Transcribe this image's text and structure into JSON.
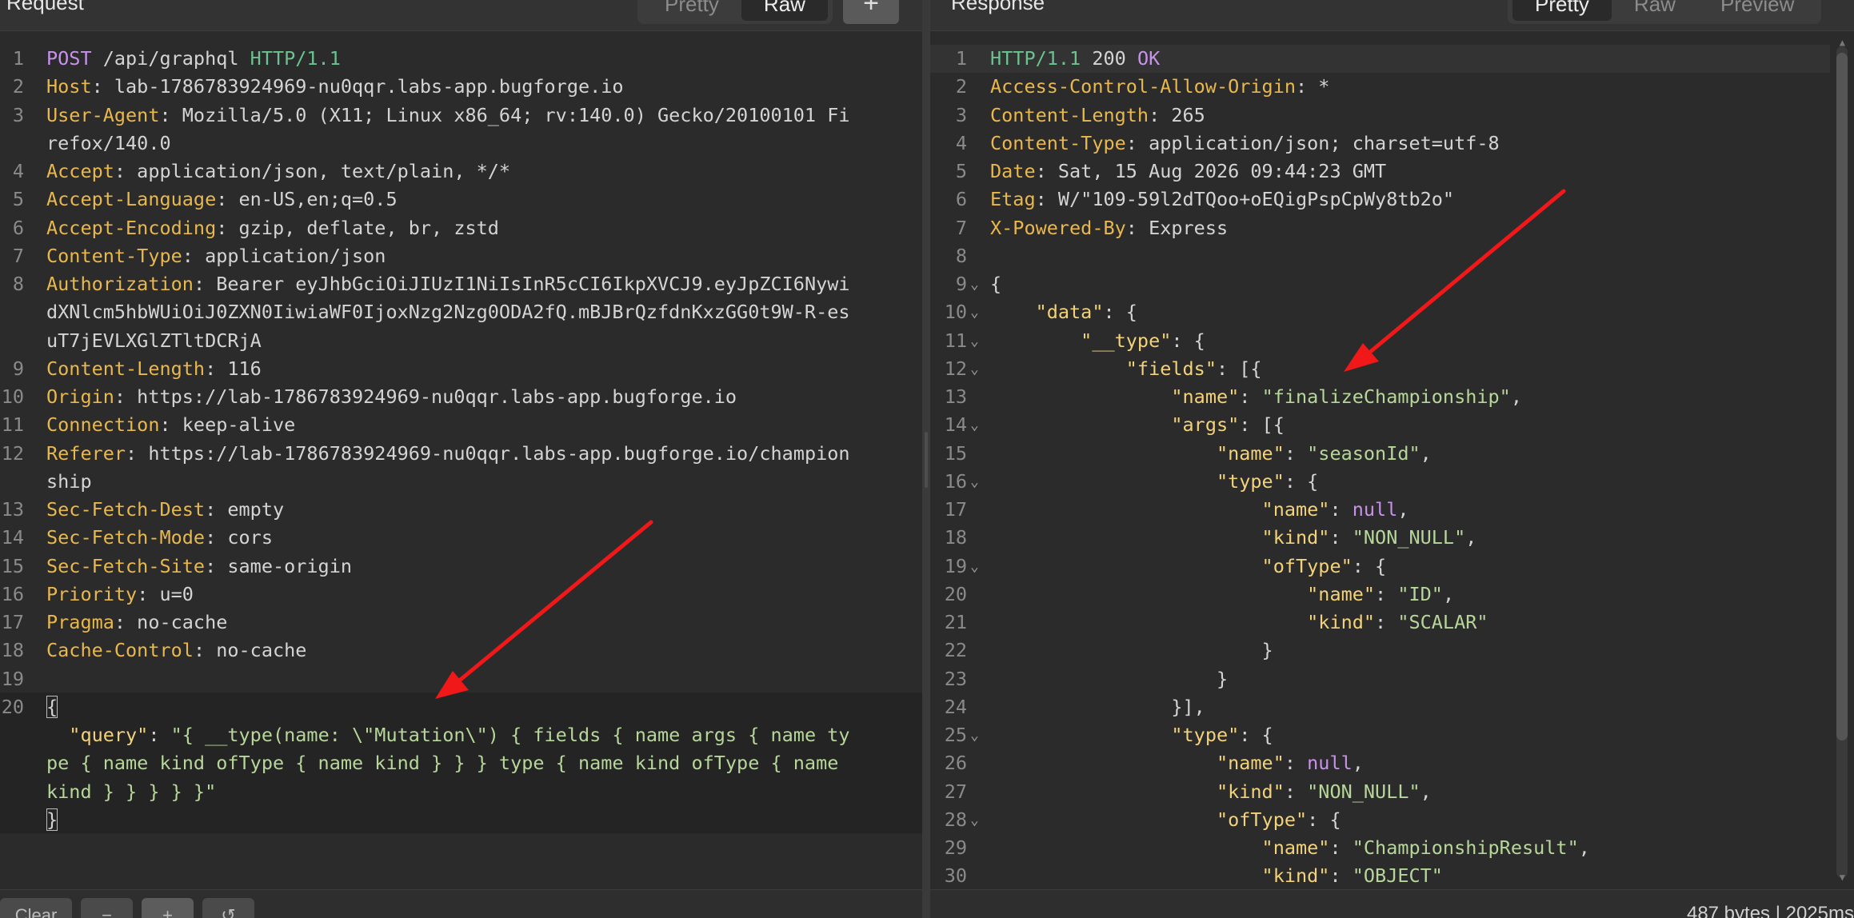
{
  "request": {
    "title": "Request",
    "tabs": [
      "Pretty",
      "Raw"
    ],
    "add_label": "+",
    "lines": [
      {
        "n": "1",
        "t": [
          {
            "c": "mt",
            "v": "POST"
          },
          {
            "c": "pl",
            "v": " /api/graphql "
          },
          {
            "c": "pr",
            "v": "HTTP/1.1"
          }
        ]
      },
      {
        "n": "2",
        "t": [
          {
            "c": "k",
            "v": "Host"
          },
          {
            "c": "pl",
            "v": ": lab-1786783924969-nu0qqr.labs-app.bugforge.io"
          }
        ]
      },
      {
        "n": "3",
        "t": [
          {
            "c": "k",
            "v": "User-Agent"
          },
          {
            "c": "pl",
            "v": ": Mozilla/5.0 (X11; Linux x86_64; rv:140.0) Gecko/20100101 Fi"
          }
        ]
      },
      {
        "n": "",
        "t": [
          {
            "c": "pl",
            "v": "refox/140.0"
          }
        ]
      },
      {
        "n": "4",
        "t": [
          {
            "c": "k",
            "v": "Accept"
          },
          {
            "c": "pl",
            "v": ": application/json, text/plain, */*"
          }
        ]
      },
      {
        "n": "5",
        "t": [
          {
            "c": "k",
            "v": "Accept-Language"
          },
          {
            "c": "pl",
            "v": ": en-US,en;q=0.5"
          }
        ]
      },
      {
        "n": "6",
        "t": [
          {
            "c": "k",
            "v": "Accept-Encoding"
          },
          {
            "c": "pl",
            "v": ": gzip, deflate, br, zstd"
          }
        ]
      },
      {
        "n": "7",
        "t": [
          {
            "c": "k",
            "v": "Content-Type"
          },
          {
            "c": "pl",
            "v": ": application/json"
          }
        ]
      },
      {
        "n": "8",
        "t": [
          {
            "c": "k",
            "v": "Authorization"
          },
          {
            "c": "pl",
            "v": ": Bearer eyJhbGciOiJIUzI1NiIsInR5cCI6IkpXVCJ9.eyJpZCI6Nywi"
          }
        ]
      },
      {
        "n": "",
        "t": [
          {
            "c": "pl",
            "v": "dXNlcm5hbWUiOiJ0ZXN0IiwiaWF0IjoxNzg2Nzg0ODA2fQ.mBJBrQzfdnKxzGG0t9W-R-es"
          }
        ]
      },
      {
        "n": "",
        "t": [
          {
            "c": "pl",
            "v": "uT7jEVLXGlZTltDCRjA"
          }
        ]
      },
      {
        "n": "9",
        "t": [
          {
            "c": "k",
            "v": "Content-Length"
          },
          {
            "c": "pl",
            "v": ": 116"
          }
        ]
      },
      {
        "n": "10",
        "t": [
          {
            "c": "k",
            "v": "Origin"
          },
          {
            "c": "pl",
            "v": ": https://lab-1786783924969-nu0qqr.labs-app.bugforge.io"
          }
        ]
      },
      {
        "n": "11",
        "t": [
          {
            "c": "k",
            "v": "Connection"
          },
          {
            "c": "pl",
            "v": ": keep-alive"
          }
        ]
      },
      {
        "n": "12",
        "t": [
          {
            "c": "k",
            "v": "Referer"
          },
          {
            "c": "pl",
            "v": ": https://lab-1786783924969-nu0qqr.labs-app.bugforge.io/champion"
          }
        ]
      },
      {
        "n": "",
        "t": [
          {
            "c": "pl",
            "v": "ship"
          }
        ]
      },
      {
        "n": "13",
        "t": [
          {
            "c": "k",
            "v": "Sec-Fetch-Dest"
          },
          {
            "c": "pl",
            "v": ": empty"
          }
        ]
      },
      {
        "n": "14",
        "t": [
          {
            "c": "k",
            "v": "Sec-Fetch-Mode"
          },
          {
            "c": "pl",
            "v": ": cors"
          }
        ]
      },
      {
        "n": "15",
        "t": [
          {
            "c": "k",
            "v": "Sec-Fetch-Site"
          },
          {
            "c": "pl",
            "v": ": same-origin"
          }
        ]
      },
      {
        "n": "16",
        "t": [
          {
            "c": "k",
            "v": "Priority"
          },
          {
            "c": "pl",
            "v": ": u=0"
          }
        ]
      },
      {
        "n": "17",
        "t": [
          {
            "c": "k",
            "v": "Pragma"
          },
          {
            "c": "pl",
            "v": ": no-cache"
          }
        ]
      },
      {
        "n": "18",
        "t": [
          {
            "c": "k",
            "v": "Cache-Control"
          },
          {
            "c": "pl",
            "v": ": no-cache"
          }
        ]
      },
      {
        "n": "19",
        "t": []
      },
      {
        "n": "20",
        "t": [
          {
            "c": "pl brk",
            "v": "{"
          }
        ]
      },
      {
        "n": "",
        "t": [
          {
            "c": "jk",
            "v": "  \"query\""
          },
          {
            "c": "pl",
            "v": ": "
          },
          {
            "c": "js",
            "v": "\"{ __type(name: \\\"Mutation\\\") { fields { name args { name ty"
          }
        ]
      },
      {
        "n": "",
        "t": [
          {
            "c": "js",
            "v": "pe { name kind ofType { name kind } } } type { name kind ofType { name"
          }
        ]
      },
      {
        "n": "",
        "t": [
          {
            "c": "js",
            "v": "kind } } } } }\""
          }
        ]
      },
      {
        "n": "",
        "t": [
          {
            "c": "pl brk",
            "v": "}"
          }
        ]
      }
    ],
    "footer": {
      "clear": "Clear",
      "minus": "−",
      "plus": "+",
      "undo": "↺"
    }
  },
  "response": {
    "title": "Response",
    "tabs": [
      "Pretty",
      "Raw",
      "Preview"
    ],
    "lines": [
      {
        "n": "1",
        "t": [
          {
            "c": "pr",
            "v": "HTTP/1.1"
          },
          {
            "c": "pl",
            "v": " 200 "
          },
          {
            "c": "mt",
            "v": "OK"
          }
        ]
      },
      {
        "n": "2",
        "t": [
          {
            "c": "k",
            "v": "Access-Control-Allow-Origin"
          },
          {
            "c": "pl",
            "v": ": *"
          }
        ]
      },
      {
        "n": "3",
        "t": [
          {
            "c": "k",
            "v": "Content-Length"
          },
          {
            "c": "pl",
            "v": ": 265"
          }
        ]
      },
      {
        "n": "4",
        "t": [
          {
            "c": "k",
            "v": "Content-Type"
          },
          {
            "c": "pl",
            "v": ": application/json; charset=utf-8"
          }
        ]
      },
      {
        "n": "5",
        "t": [
          {
            "c": "k",
            "v": "Date"
          },
          {
            "c": "pl",
            "v": ": Sat, 15 Aug 2026 09:44:23 GMT"
          }
        ]
      },
      {
        "n": "6",
        "t": [
          {
            "c": "k",
            "v": "Etag"
          },
          {
            "c": "pl",
            "v": ": W/\"109-59l2dTQoo+oEQigPspCpWy8tb2o\""
          }
        ]
      },
      {
        "n": "7",
        "t": [
          {
            "c": "k",
            "v": "X-Powered-By"
          },
          {
            "c": "pl",
            "v": ": Express"
          }
        ]
      },
      {
        "n": "8",
        "t": []
      },
      {
        "n": "9",
        "f": "⌄",
        "t": [
          {
            "c": "pl",
            "v": "{"
          }
        ]
      },
      {
        "n": "10",
        "f": "⌄",
        "t": [
          {
            "c": "jk",
            "v": "    \"data\""
          },
          {
            "c": "pl",
            "v": ": {"
          }
        ]
      },
      {
        "n": "11",
        "f": "⌄",
        "t": [
          {
            "c": "jk",
            "v": "        \"__type\""
          },
          {
            "c": "pl",
            "v": ": {"
          }
        ]
      },
      {
        "n": "12",
        "f": "⌄",
        "t": [
          {
            "c": "jk",
            "v": "            \"fields\""
          },
          {
            "c": "pl",
            "v": ": [{"
          }
        ]
      },
      {
        "n": "13",
        "t": [
          {
            "c": "jk",
            "v": "                \"name\""
          },
          {
            "c": "pl",
            "v": ": "
          },
          {
            "c": "js",
            "v": "\"finalizeChampionship\""
          },
          {
            "c": "pl",
            "v": ","
          }
        ]
      },
      {
        "n": "14",
        "f": "⌄",
        "t": [
          {
            "c": "jk",
            "v": "                \"args\""
          },
          {
            "c": "pl",
            "v": ": [{"
          }
        ]
      },
      {
        "n": "15",
        "t": [
          {
            "c": "jk",
            "v": "                    \"name\""
          },
          {
            "c": "pl",
            "v": ": "
          },
          {
            "c": "js",
            "v": "\"seasonId\""
          },
          {
            "c": "pl",
            "v": ","
          }
        ]
      },
      {
        "n": "16",
        "f": "⌄",
        "t": [
          {
            "c": "jk",
            "v": "                    \"type\""
          },
          {
            "c": "pl",
            "v": ": {"
          }
        ]
      },
      {
        "n": "17",
        "t": [
          {
            "c": "jk",
            "v": "                        \"name\""
          },
          {
            "c": "pl",
            "v": ": "
          },
          {
            "c": "nl",
            "v": "null"
          },
          {
            "c": "pl",
            "v": ","
          }
        ]
      },
      {
        "n": "18",
        "t": [
          {
            "c": "jk",
            "v": "                        \"kind\""
          },
          {
            "c": "pl",
            "v": ": "
          },
          {
            "c": "js",
            "v": "\"NON_NULL\""
          },
          {
            "c": "pl",
            "v": ","
          }
        ]
      },
      {
        "n": "19",
        "f": "⌄",
        "t": [
          {
            "c": "jk",
            "v": "                        \"ofType\""
          },
          {
            "c": "pl",
            "v": ": {"
          }
        ]
      },
      {
        "n": "20",
        "t": [
          {
            "c": "jk",
            "v": "                            \"name\""
          },
          {
            "c": "pl",
            "v": ": "
          },
          {
            "c": "js",
            "v": "\"ID\""
          },
          {
            "c": "pl",
            "v": ","
          }
        ]
      },
      {
        "n": "21",
        "t": [
          {
            "c": "jk",
            "v": "                            \"kind\""
          },
          {
            "c": "pl",
            "v": ": "
          },
          {
            "c": "js",
            "v": "\"SCALAR\""
          }
        ]
      },
      {
        "n": "22",
        "t": [
          {
            "c": "pl",
            "v": "                        }"
          }
        ]
      },
      {
        "n": "23",
        "t": [
          {
            "c": "pl",
            "v": "                    }"
          }
        ]
      },
      {
        "n": "24",
        "t": [
          {
            "c": "pl",
            "v": "                }],"
          }
        ]
      },
      {
        "n": "25",
        "f": "⌄",
        "t": [
          {
            "c": "jk",
            "v": "                \"type\""
          },
          {
            "c": "pl",
            "v": ": {"
          }
        ]
      },
      {
        "n": "26",
        "t": [
          {
            "c": "jk",
            "v": "                    \"name\""
          },
          {
            "c": "pl",
            "v": ": "
          },
          {
            "c": "nl",
            "v": "null"
          },
          {
            "c": "pl",
            "v": ","
          }
        ]
      },
      {
        "n": "27",
        "t": [
          {
            "c": "jk",
            "v": "                    \"kind\""
          },
          {
            "c": "pl",
            "v": ": "
          },
          {
            "c": "js",
            "v": "\"NON_NULL\""
          },
          {
            "c": "pl",
            "v": ","
          }
        ]
      },
      {
        "n": "28",
        "f": "⌄",
        "t": [
          {
            "c": "jk",
            "v": "                    \"ofType\""
          },
          {
            "c": "pl",
            "v": ": {"
          }
        ]
      },
      {
        "n": "29",
        "t": [
          {
            "c": "jk",
            "v": "                        \"name\""
          },
          {
            "c": "pl",
            "v": ": "
          },
          {
            "c": "js",
            "v": "\"ChampionshipResult\""
          },
          {
            "c": "pl",
            "v": ","
          }
        ]
      },
      {
        "n": "30",
        "t": [
          {
            "c": "jk",
            "v": "                        \"kind\""
          },
          {
            "c": "pl",
            "v": ": "
          },
          {
            "c": "js",
            "v": "\"OBJECT\""
          }
        ]
      }
    ],
    "status": "487 bytes | 2025ms"
  },
  "colors": {
    "arrow": "#f01818",
    "background": "#2b2b2b",
    "header_key": "#e9b84d",
    "json_key": "#f2d27a",
    "json_string": "#b7d69a",
    "keyword": "#c792ea"
  }
}
